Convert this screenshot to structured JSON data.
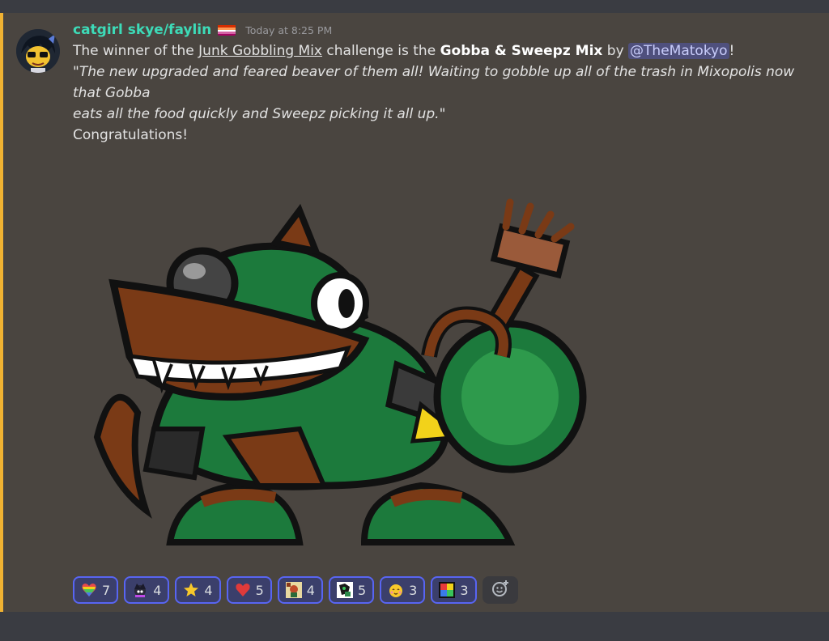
{
  "message": {
    "author": "catgirl skye/faylin",
    "timestamp": "Today at 8:25 PM",
    "line1": {
      "pre": "The winner of the ",
      "link": "Junk Gobbling Mix",
      "mid": " challenge is the ",
      "bold": "Gobba & Sweepz Mix",
      "by": " by ",
      "mention": "@TheMatokyo",
      "end": "!"
    },
    "quote_line1": "\"The new upgraded and feared beaver of them all! Waiting to gobble up all of the trash in Mixopolis now that Gobba",
    "quote_line2": "eats all the food quickly and Sweepz picking it all up.\"",
    "closing": "Congratulations!"
  },
  "reactions": [
    {
      "icon": "rainbow-heart-emoji",
      "count": "7"
    },
    {
      "icon": "character-emoji",
      "count": "4"
    },
    {
      "icon": "star-emoji",
      "count": "4"
    },
    {
      "icon": "red-heart-emoji",
      "count": "5"
    },
    {
      "icon": "character-art-emoji",
      "count": "4"
    },
    {
      "icon": "character-art-emoji-2",
      "count": "5"
    },
    {
      "icon": "partying-face-emoji",
      "count": "3"
    },
    {
      "icon": "color-square-emoji",
      "count": "3"
    }
  ],
  "colors": {
    "username": "#3ddbb8",
    "highlight_border": "#f0b232",
    "reaction_border": "#5865f2"
  }
}
